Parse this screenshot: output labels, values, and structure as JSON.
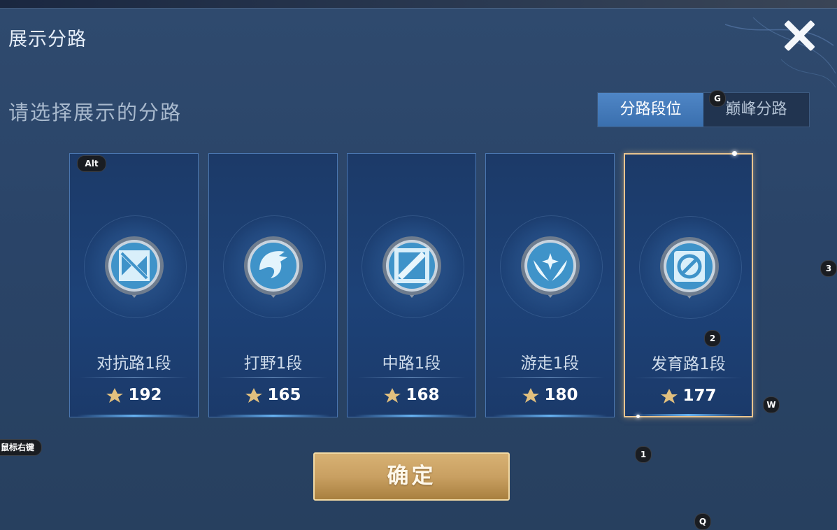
{
  "dialog": {
    "title": "展示分路",
    "subtitle": "请选择展示的分路",
    "tabs": [
      {
        "label": "分路段位",
        "active": true
      },
      {
        "label": "巅峰分路",
        "active": false
      }
    ],
    "confirm_label": "确定"
  },
  "cards": [
    {
      "name": "对抗路1段",
      "score": "192",
      "icon": "clash-lane-icon",
      "selected": false
    },
    {
      "name": "打野1段",
      "score": "165",
      "icon": "jungle-dragon-icon",
      "selected": false
    },
    {
      "name": "中路1段",
      "score": "168",
      "icon": "mid-lane-icon",
      "selected": false
    },
    {
      "name": "游走1段",
      "score": "180",
      "icon": "roam-wings-icon",
      "selected": false
    },
    {
      "name": "发育路1段",
      "score": "177",
      "icon": "farm-lane-icon",
      "selected": true
    }
  ],
  "key_hints": {
    "alt": "Alt",
    "g": "G",
    "three": "3",
    "two": "2",
    "w": "W",
    "right_click": "鼠标右键",
    "one": "1",
    "q": "Q"
  },
  "colors": {
    "accent_tab": "#4f86c6",
    "selected_border": "#e9c48f",
    "confirm_gold": "#c9a062"
  }
}
